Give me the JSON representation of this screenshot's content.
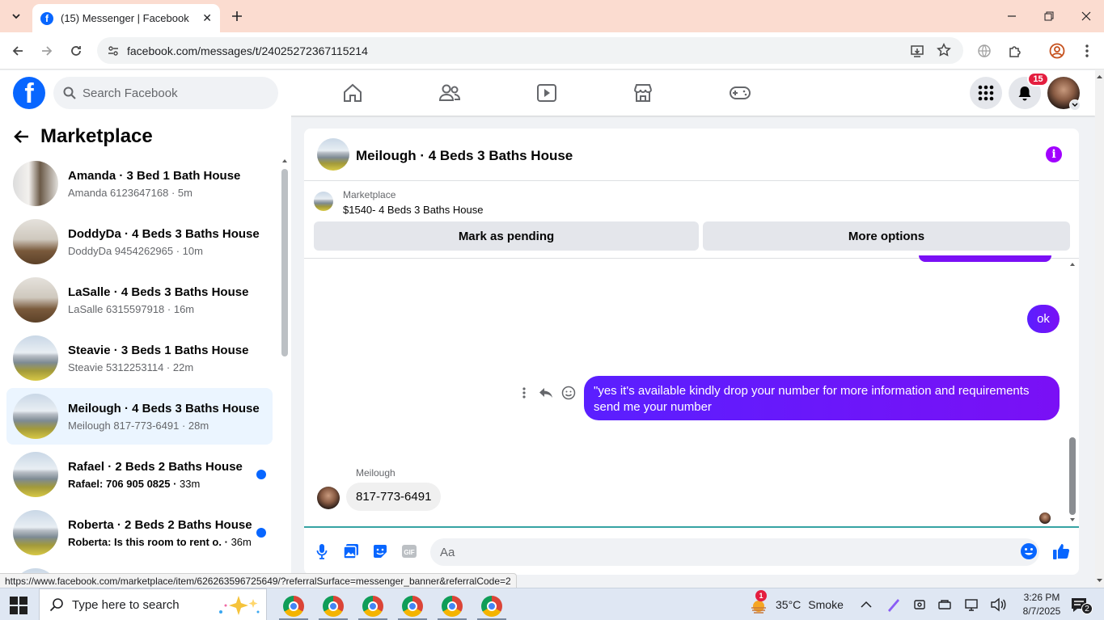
{
  "browser": {
    "tab_title": "(15) Messenger | Facebook",
    "url": "facebook.com/messages/t/24025272367115214",
    "status_url": "https://www.facebook.com/marketplace/item/626263596725649/?referralSurface=messenger_banner&referralCode=2"
  },
  "facebook": {
    "search_placeholder": "Search Facebook",
    "notification_count": "15",
    "brand_color": "#0866ff"
  },
  "sidebar": {
    "title": "Marketplace",
    "conversations": [
      {
        "name": "Amanda · 3 Bed 1 Bath House",
        "preview": "Amanda 6123647168",
        "time": "5m",
        "unread": false,
        "selected": false
      },
      {
        "name": "DoddyDa · 4 Beds 3 Baths House",
        "preview": "DoddyDa 9454262965",
        "time": "10m",
        "unread": false,
        "selected": false
      },
      {
        "name": "LaSalle · 4 Beds 3 Baths House",
        "preview": "LaSalle 6315597918",
        "time": "16m",
        "unread": false,
        "selected": false
      },
      {
        "name": "Steavie · 3 Beds 1 Baths House",
        "preview": "Steavie 5312253114",
        "time": "22m",
        "unread": false,
        "selected": false
      },
      {
        "name": "Meilough · 4 Beds 3 Baths House",
        "preview": "Meilough 817-773-6491",
        "time": "28m",
        "unread": false,
        "selected": true
      },
      {
        "name": "Rafael · 2 Beds 2 Baths House",
        "preview": "Rafael: 706 905 0825",
        "time": "33m",
        "unread": true,
        "selected": false
      },
      {
        "name": "Roberta · 2 Beds 2 Baths House",
        "preview": "Roberta: Is this room to rent o...",
        "time": "36m",
        "unread": true,
        "selected": false
      }
    ]
  },
  "chat": {
    "title": "Meilough · 4 Beds 3 Baths House",
    "banner_label": "Marketplace",
    "banner_listing": "$1540- 4 Beds 3 Baths House",
    "mark_pending_label": "Mark as pending",
    "more_options_label": "More options",
    "messages": {
      "out_short": "ok",
      "out_long": "\"yes it's available kindly drop your number for more information and requirements send me your number",
      "in_sender": "Meilough",
      "in_text": "817-773-6491"
    },
    "input_placeholder": "Aa",
    "accent_color": "#5b1fff"
  },
  "taskbar": {
    "search_placeholder": "Type here to search",
    "weather_temp": "35°C",
    "weather_desc": "Smoke",
    "weather_badge": "1",
    "time": "3:26 PM",
    "date": "8/7/2025",
    "notif_count": "2"
  }
}
